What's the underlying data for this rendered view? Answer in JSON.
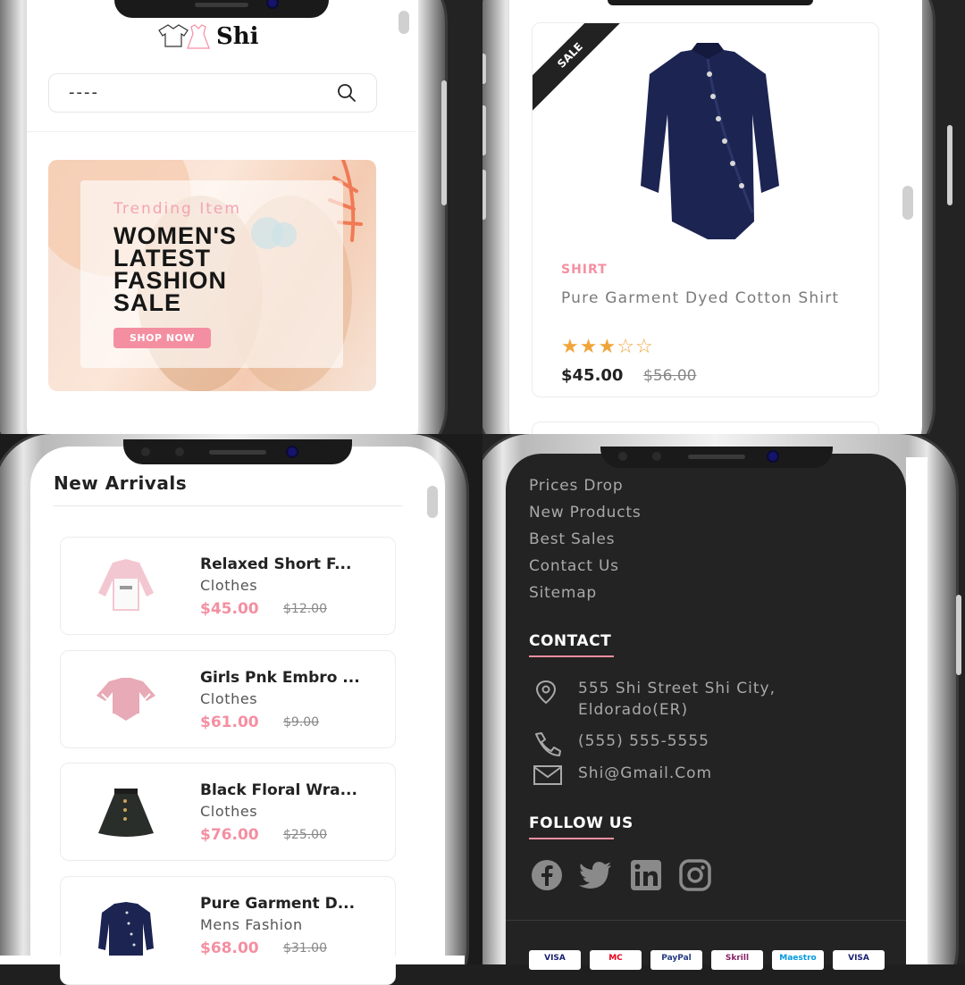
{
  "q1": {
    "logo_text": "Shi",
    "search": {
      "value": "----"
    },
    "banner": {
      "trending_label": "Trending Item",
      "headline_lines": [
        "WOMEN'S",
        "LATEST",
        "FASHION",
        "SALE"
      ],
      "button_label": "SHOP NOW"
    }
  },
  "q2": {
    "product": {
      "badge": "SALE",
      "category": "SHIRT",
      "name": "Pure Garment Dyed Cotton Shirt",
      "rating": 3,
      "rating_max": 5,
      "price": "$45.00",
      "old_price": "$56.00"
    }
  },
  "q3": {
    "section_title": "New Arrivals",
    "items": [
      {
        "title": "Relaxed Short F...",
        "category": "Clothes",
        "price": "$45.00",
        "old_price": "$12.00"
      },
      {
        "title": "Girls Pnk Embro ...",
        "category": "Clothes",
        "price": "$61.00",
        "old_price": "$9.00"
      },
      {
        "title": "Black Floral Wra...",
        "category": "Clothes",
        "price": "$76.00",
        "old_price": "$25.00"
      },
      {
        "title": "Pure Garment D...",
        "category": "Mens Fashion",
        "price": "$68.00",
        "old_price": "$31.00"
      }
    ]
  },
  "q4": {
    "links": [
      "Prices Drop",
      "New Products",
      "Best Sales",
      "Contact Us",
      "Sitemap"
    ],
    "contact_title": "CONTACT",
    "address_line1": "555 Shi Street Shi City,",
    "address_line2": "Eldorado(ER)",
    "phone": "(555) 555-5555",
    "email": "Shi@Gmail.Com",
    "follow_title": "FOLLOW US",
    "social": [
      "facebook-icon",
      "twitter-icon",
      "linkedin-icon",
      "instagram-icon"
    ],
    "payments": [
      "VISA",
      "MC",
      "PayPal",
      "Skrill",
      "Maestro",
      "VISA"
    ]
  },
  "colors": {
    "accent": "#f48fa1",
    "star": "#f0a53a",
    "dark": "#232323"
  }
}
